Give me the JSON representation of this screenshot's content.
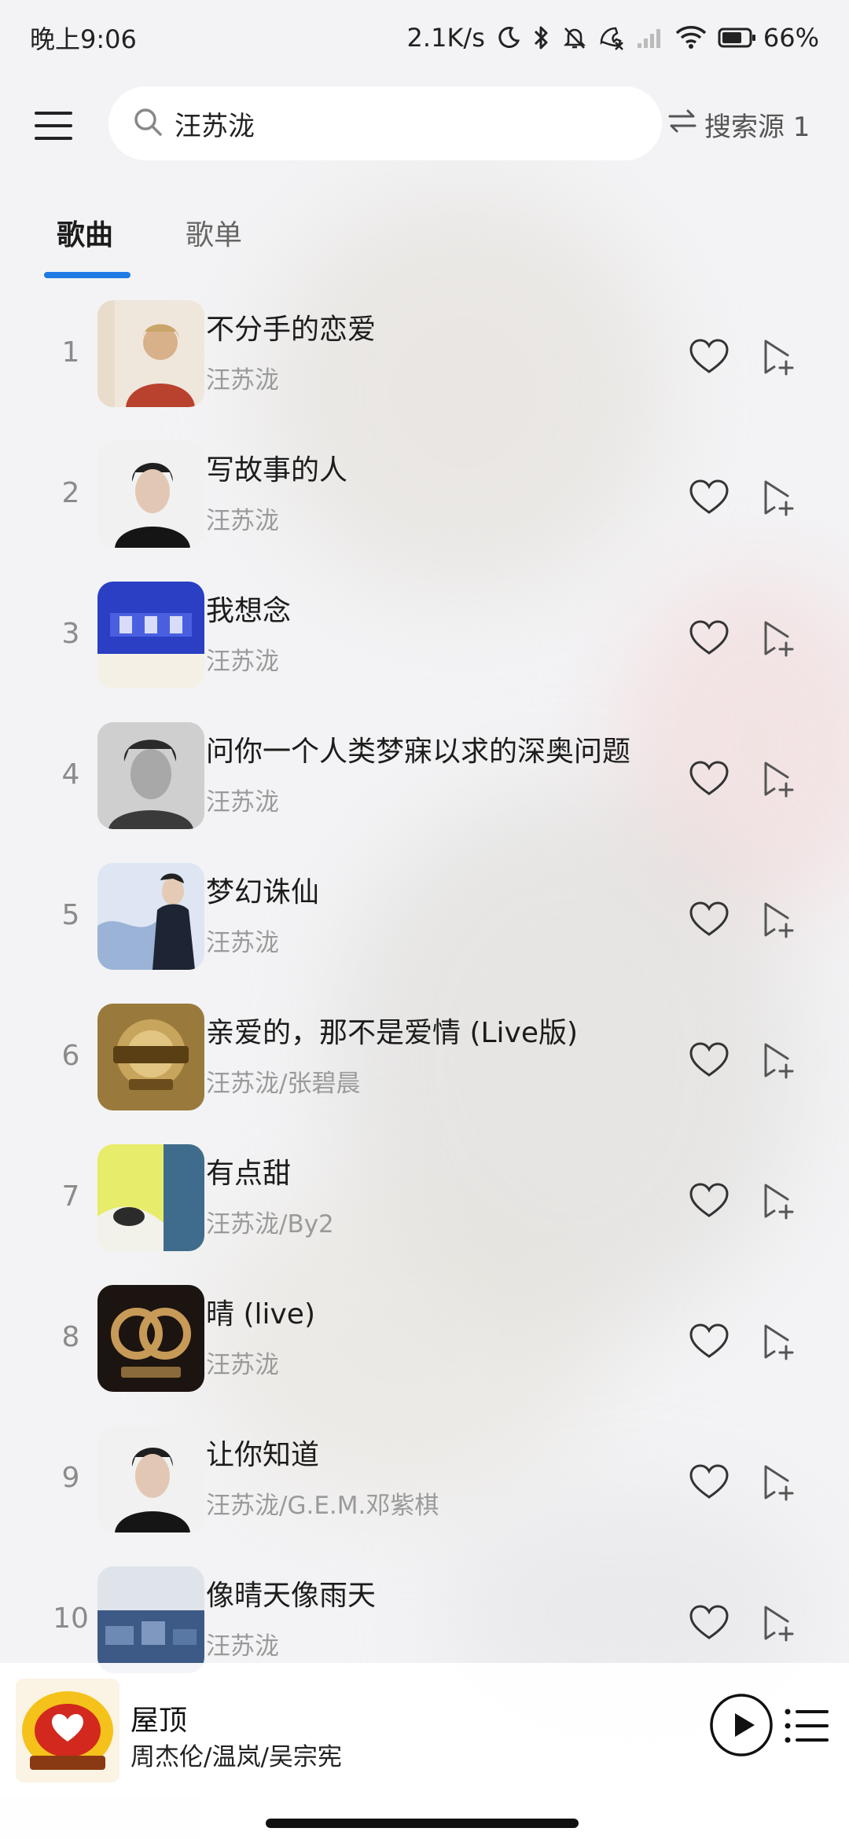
{
  "status_bar": {
    "time": "晚上9:06",
    "net_speed": "2.1K/s",
    "battery": "66%"
  },
  "search": {
    "query": "汪苏泷",
    "source_label": "搜索源 1"
  },
  "tabs": {
    "songs": "歌曲",
    "playlists": "歌单"
  },
  "songs": [
    {
      "index": "1",
      "title": "不分手的恋爱",
      "artist": "汪苏泷"
    },
    {
      "index": "2",
      "title": "写故事的人",
      "artist": "汪苏泷"
    },
    {
      "index": "3",
      "title": "我想念",
      "artist": "汪苏泷"
    },
    {
      "index": "4",
      "title": "问你一个人类梦寐以求的深奥问题",
      "artist": "汪苏泷"
    },
    {
      "index": "5",
      "title": "梦幻诛仙",
      "artist": "汪苏泷"
    },
    {
      "index": "6",
      "title": "亲爱的，那不是爱情 (Live版)",
      "artist": "汪苏泷/张碧晨"
    },
    {
      "index": "7",
      "title": "有点甜",
      "artist": "汪苏泷/By2"
    },
    {
      "index": "8",
      "title": "晴 (live)",
      "artist": "汪苏泷"
    },
    {
      "index": "9",
      "title": "让你知道",
      "artist": "汪苏泷/G.E.M.邓紫棋"
    },
    {
      "index": "10",
      "title": "像晴天像雨天",
      "artist": "汪苏泷"
    }
  ],
  "now_playing": {
    "title": "屋顶",
    "artist": "周杰伦/温岚/吴宗宪"
  },
  "colors": {
    "accent": "#1f7be4"
  }
}
